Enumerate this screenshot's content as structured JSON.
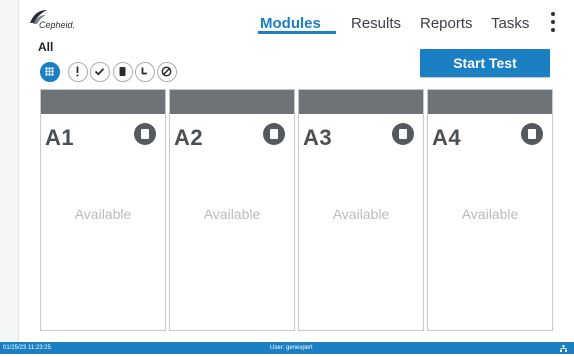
{
  "header": {
    "logo_text": "Cepheid.",
    "nav": [
      {
        "label": "Modules",
        "active": true
      },
      {
        "label": "Results",
        "active": false
      },
      {
        "label": "Reports",
        "active": false
      },
      {
        "label": "Tasks",
        "active": false
      }
    ],
    "menu_icon": "more-vertical-icon"
  },
  "filter": {
    "title": "All",
    "icons": [
      "all-grid-icon",
      "alert-icon",
      "check-icon",
      "cartridge-icon",
      "clock-icon",
      "disabled-icon"
    ],
    "active_index": 0
  },
  "start_test_label": "Start Test",
  "modules": [
    {
      "id": "A1",
      "status": "Available",
      "status_icon": "cartridge-icon"
    },
    {
      "id": "A2",
      "status": "Available",
      "status_icon": "cartridge-icon"
    },
    {
      "id": "A3",
      "status": "Available",
      "status_icon": "cartridge-icon"
    },
    {
      "id": "A4",
      "status": "Available",
      "status_icon": "cartridge-icon"
    }
  ],
  "status_bar": {
    "datetime": "01/25/23 11:23:25",
    "user": "User: genexpert",
    "network_icon": "network-icon"
  },
  "colors": {
    "accent": "#1b7fc4",
    "card_header": "#6e7377",
    "available_text": "#b8bcc0"
  }
}
